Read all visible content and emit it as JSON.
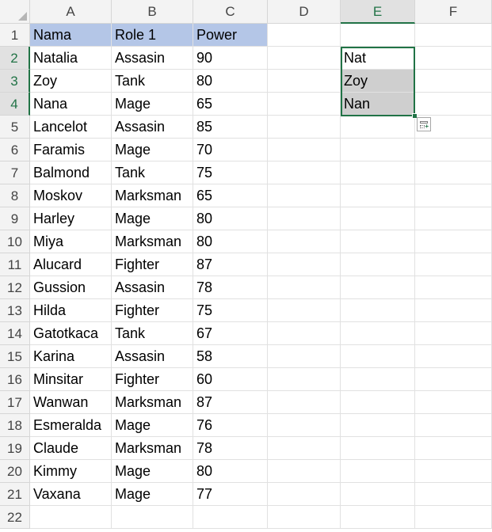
{
  "columns": [
    "A",
    "B",
    "C",
    "D",
    "E",
    "F"
  ],
  "selected_column": "E",
  "rows": [
    "1",
    "2",
    "3",
    "4",
    "5",
    "6",
    "7",
    "8",
    "9",
    "10",
    "11",
    "12",
    "13",
    "14",
    "15",
    "16",
    "17",
    "18",
    "19",
    "20",
    "21",
    "22"
  ],
  "selected_rows": [
    "2",
    "3",
    "4"
  ],
  "table_header": {
    "nama": "Nama",
    "role": "Role 1",
    "power": "Power"
  },
  "table_rows": [
    {
      "nama": "Natalia",
      "role": "Assasin",
      "power": "90"
    },
    {
      "nama": "Zoy",
      "role": "Tank",
      "power": "80"
    },
    {
      "nama": "Nana",
      "role": "Mage",
      "power": "65"
    },
    {
      "nama": "Lancelot",
      "role": "Assasin",
      "power": "85"
    },
    {
      "nama": "Faramis",
      "role": "Mage",
      "power": "70"
    },
    {
      "nama": "Balmond",
      "role": "Tank",
      "power": "75"
    },
    {
      "nama": "Moskov",
      "role": "Marksman",
      "power": "65"
    },
    {
      "nama": "Harley",
      "role": "Mage",
      "power": "80"
    },
    {
      "nama": "Miya",
      "role": "Marksman",
      "power": "80"
    },
    {
      "nama": "Alucard",
      "role": "Fighter",
      "power": "87"
    },
    {
      "nama": "Gussion",
      "role": "Assasin",
      "power": "78"
    },
    {
      "nama": "Hilda",
      "role": "Fighter",
      "power": "75"
    },
    {
      "nama": "Gatotkaca",
      "role": "Tank",
      "power": "67"
    },
    {
      "nama": "Karina",
      "role": "Assasin",
      "power": "58"
    },
    {
      "nama": "Minsitar",
      "role": "Fighter",
      "power": "60"
    },
    {
      "nama": "Wanwan",
      "role": "Marksman",
      "power": "87"
    },
    {
      "nama": "Esmeralda",
      "role": "Mage",
      "power": "76"
    },
    {
      "nama": "Claude",
      "role": "Marksman",
      "power": "78"
    },
    {
      "nama": "Kimmy",
      "role": "Mage",
      "power": "80"
    },
    {
      "nama": "Vaxana",
      "role": "Mage",
      "power": "77"
    }
  ],
  "flash_fill": [
    "Nat",
    "Zoy",
    "Nan"
  ],
  "colors": {
    "header_fill": "#b4c6e7",
    "selection_border": "#217346",
    "selection_fill": "#cfcfcf"
  },
  "icons": {
    "quick_analysis": "quick-analysis-icon",
    "select_all": "select-all-triangle-icon"
  }
}
